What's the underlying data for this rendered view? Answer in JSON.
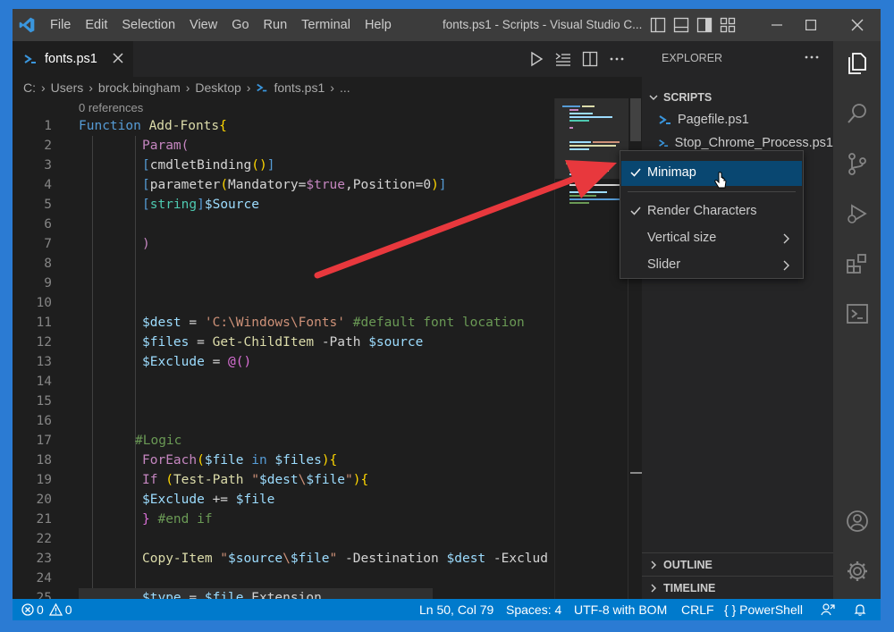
{
  "title_bar": {
    "menu": [
      "File",
      "Edit",
      "Selection",
      "View",
      "Go",
      "Run",
      "Terminal",
      "Help"
    ],
    "window_title": "fonts.ps1 - Scripts - Visual Studio C..."
  },
  "tab": {
    "label": "fonts.ps1"
  },
  "breadcrumb": [
    "C:",
    "Users",
    "brock.bingham",
    "Desktop",
    "fonts.ps1",
    "..."
  ],
  "code_lens": "0 references",
  "code_lines": [
    {
      "n": "1"
    },
    {
      "n": "2"
    },
    {
      "n": "3"
    },
    {
      "n": "4"
    },
    {
      "n": "5"
    },
    {
      "n": "6"
    },
    {
      "n": "7"
    },
    {
      "n": "8"
    },
    {
      "n": "9"
    },
    {
      "n": "10"
    },
    {
      "n": "11"
    },
    {
      "n": "12"
    },
    {
      "n": "13"
    },
    {
      "n": "14"
    },
    {
      "n": "15"
    },
    {
      "n": "16"
    },
    {
      "n": "17"
    },
    {
      "n": "18"
    },
    {
      "n": "19"
    },
    {
      "n": "20"
    },
    {
      "n": "21"
    },
    {
      "n": "22"
    },
    {
      "n": "23"
    },
    {
      "n": "24"
    },
    {
      "n": "25"
    }
  ],
  "code": {
    "l1a": "Function ",
    "l1b": "Add-Fonts",
    "l1c": "{",
    "l2": "Param(",
    "l3a": "[",
    "l3b": "cmdletBinding",
    "l3c": "()",
    "l3d": "]",
    "l4a": "[",
    "l4b": "parameter",
    "l4c": "(",
    "l4d": "Mandatory",
    "l4e": "=",
    "l4f": "$true",
    "l4g": ",",
    "l4h": "Position",
    "l4i": "=0",
    "l4j": ")",
    "l4k": "]",
    "l5a": "[",
    "l5b": "string",
    "l5c": "]",
    "l5d": "$Source",
    "l7": ")",
    "l11a": "$dest",
    "l11b": " = ",
    "l11c": "'C:\\Windows\\Fonts'",
    "l11d": " #default font location",
    "l12a": "$files",
    "l12b": " = ",
    "l12c": "Get-ChildItem",
    "l12d": " -Path ",
    "l12e": "$source",
    "l13a": "$Exclude",
    "l13b": " = ",
    "l13c": "@()",
    "l17": "#Logic",
    "l18a": "ForEach",
    "l18b": "(",
    "l18c": "$file",
    "l18d": " in ",
    "l18e": "$files",
    "l18f": "){",
    "l19a": "If",
    "l19b": " (",
    "l19c": "Test-Path",
    "l19d": " \"",
    "l19e": "$dest",
    "l19f": "\\",
    "l19g": "$file",
    "l19h": "\"",
    "l19i": "){",
    "l20a": "$Exclude",
    "l20b": " += ",
    "l20c": "$file",
    "l21a": "}",
    "l21b": " #end if",
    "l23a": "Copy-Item",
    "l23b": " \"",
    "l23c": "$source",
    "l23d": "\\",
    "l23e": "$file",
    "l23f": "\"",
    "l23g": " -Destination ",
    "l23h": "$dest",
    "l23i": " -Exclud",
    "l25a": "$type",
    "l25b": " = ",
    "l25c": "$file",
    "l25d": ".Extension"
  },
  "explorer": {
    "header": "EXPLORER",
    "section": "SCRIPTS",
    "files": [
      "Pagefile.ps1",
      "Stop_Chrome_Process.ps1"
    ],
    "outline": "OUTLINE",
    "timeline": "TIMELINE"
  },
  "context_menu": {
    "items": [
      {
        "label": "Minimap",
        "checked": true
      },
      {
        "label": "Render Characters",
        "checked": true
      },
      {
        "label": "Vertical size",
        "submenu": true
      },
      {
        "label": "Slider",
        "submenu": true
      }
    ]
  },
  "status_bar": {
    "errors": "0",
    "warnings": "0",
    "position": "Ln 50, Col 79",
    "spaces": "Spaces: 4",
    "encoding": "UTF-8 with BOM",
    "eol": "CRLF",
    "language": "PowerShell",
    "language_prefix": "{ }"
  },
  "colors": {
    "accent": "#007acc",
    "arrow": "#e8383d",
    "menu_highlight": "#094771"
  }
}
